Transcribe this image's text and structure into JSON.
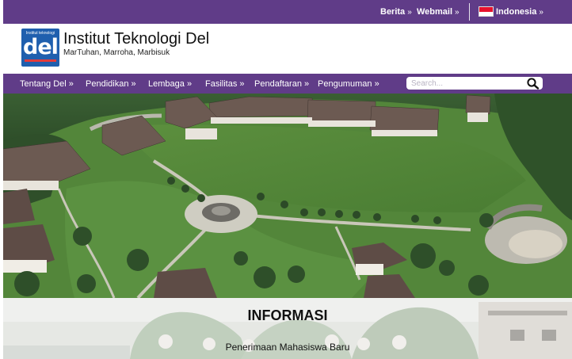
{
  "topbar": {
    "berita": "Berita",
    "webmail": "Webmail",
    "language": "Indonesia",
    "chevron": "»",
    "color": "#603c88"
  },
  "brand": {
    "logo_small_text": "Institut teknologi",
    "logo_word": "del",
    "title": "Institut Teknologi Del",
    "motto": "MarTuhan, Marroha, Marbisuk"
  },
  "nav": {
    "items": [
      "Tentang Del",
      "Pendidikan",
      "Lembaga",
      "Fasilitas",
      "Pendaftaran",
      "Pengumuman"
    ],
    "chevron": "»",
    "search_placeholder": "Search..."
  },
  "info": {
    "title": "INFORMASI",
    "subtitle": "Penerimaan Mahasiswa Baru"
  }
}
